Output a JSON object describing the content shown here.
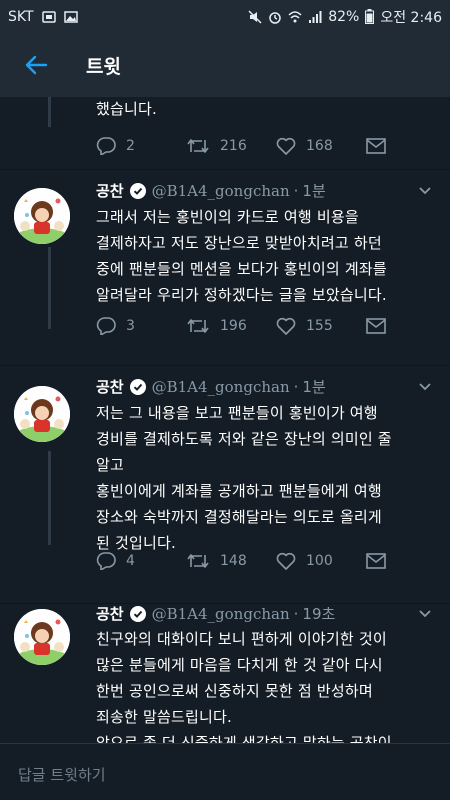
{
  "status_bar": {
    "carrier": "SKT",
    "battery": "82%",
    "time": "오전 2:46"
  },
  "header": {
    "title": "트윗",
    "back_icon": "arrow-left-icon"
  },
  "tweets": [
    {
      "partial": true,
      "text": "했습니다.",
      "replies": "2",
      "retweets": "216",
      "likes": "168"
    },
    {
      "name": "공찬",
      "handle": "@B1A4_gongchan",
      "time": "1분",
      "text": "그래서 저는 홍빈이의 카드로 여행 비용을\n결제하자고 저도 장난으로 맞받아치려고 하던\n중에 팬분들의 멘션을 보다가 홍빈이의 계좌를\n알려달라 우리가 정하겠다는 글을 보았습니다.",
      "replies": "3",
      "retweets": "196",
      "likes": "155"
    },
    {
      "name": "공찬",
      "handle": "@B1A4_gongchan",
      "time": "1분",
      "text": "저는 그 내용을 보고 팬분들이 홍빈이가 여행\n경비를 결제하도록 저와 같은 장난의 의미인 줄\n알고\n홍빈이에게 계좌를 공개하고 팬분들에게 여행\n장소와 숙박까지 결정해달라는 의도로 올리게\n된 것입니다.",
      "replies": "4",
      "retweets": "148",
      "likes": "100"
    },
    {
      "name": "공찬",
      "handle": "@B1A4_gongchan",
      "time": "19초",
      "text": "친구와의 대화이다 보니 편하게 이야기한 것이\n많은 분들에게 마음을 다치게 한 것 같아 다시\n한번 공인으로써 신중하지 못한 점 반성하며\n죄송한 말씀드립니다.\n앞으로 좀 더 신중하게 생각하고 말하는 공찬이"
    }
  ],
  "reply_bar": {
    "placeholder": "답글 트윗하기"
  },
  "colors": {
    "background": "#141d26",
    "bar": "#202b36",
    "accent": "#1da1f2",
    "secondary_text": "#8899a6"
  }
}
